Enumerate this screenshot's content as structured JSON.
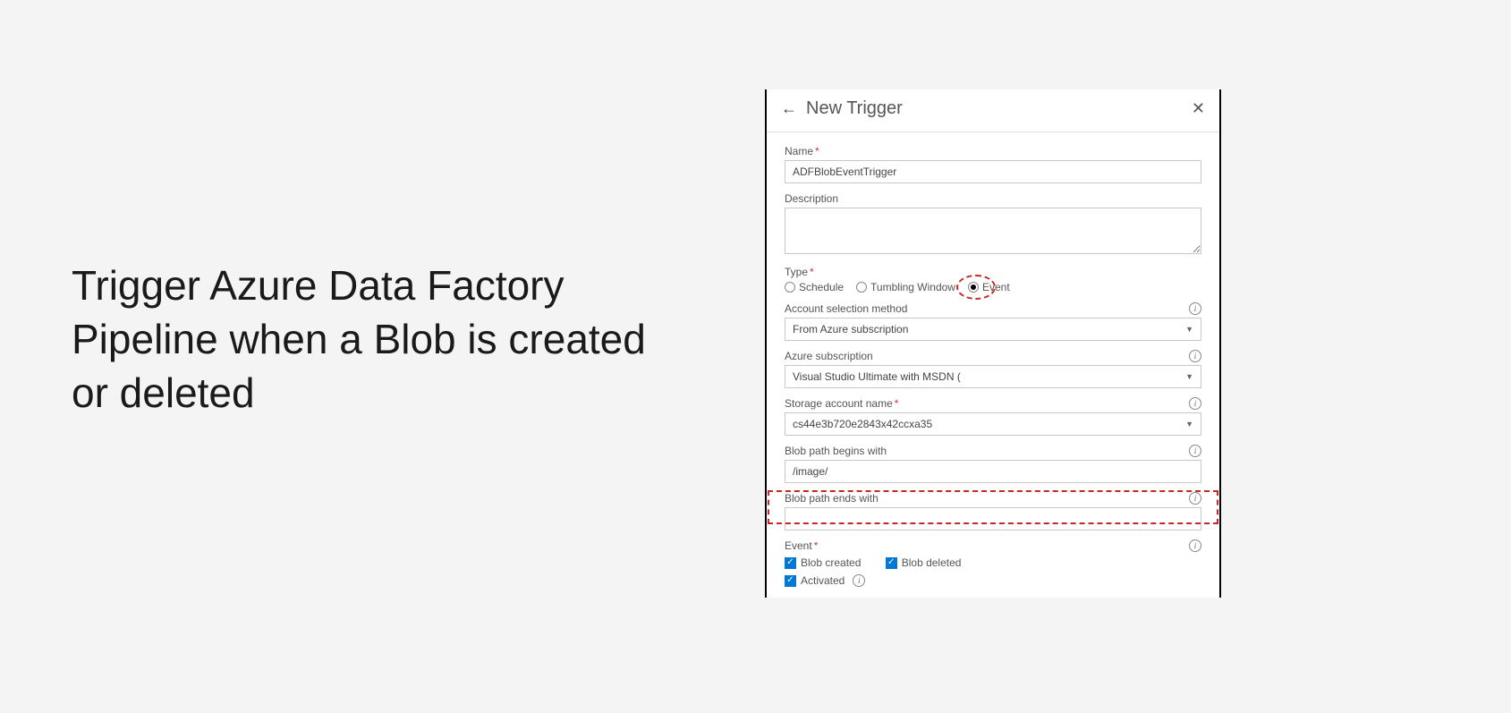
{
  "slide": {
    "title": "Trigger Azure Data Factory Pipeline when a Blob is created or deleted"
  },
  "panel": {
    "header_title": "New Trigger",
    "fields": {
      "name_label": "Name",
      "name_value": "ADFBlobEventTrigger",
      "description_label": "Description",
      "description_value": "",
      "type_label": "Type",
      "type_options": {
        "schedule": "Schedule",
        "tumbling": "Tumbling Window",
        "event": "Event"
      },
      "type_selected": "event",
      "account_method_label": "Account selection method",
      "account_method_value": "From Azure subscription",
      "subscription_label": "Azure subscription",
      "subscription_value": "Visual Studio Ultimate with MSDN (",
      "storage_label": "Storage account name",
      "storage_value": "cs44e3b720e2843x42ccxa35",
      "path_begins_label": "Blob path begins with",
      "path_begins_value": "/image/",
      "path_ends_label": "Blob path ends with",
      "path_ends_value": "",
      "event_label": "Event",
      "event_blob_created": "Blob created",
      "event_blob_deleted": "Blob deleted",
      "activated_label": "Activated"
    }
  }
}
